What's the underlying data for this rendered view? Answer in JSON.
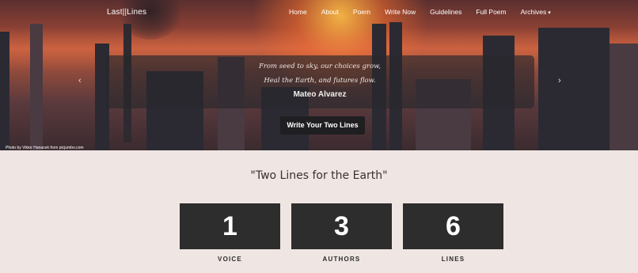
{
  "nav": {
    "brand": "Last||Lines",
    "links": [
      "Home",
      "About",
      "Poem",
      "Write Now",
      "Guidelines",
      "Full Poem",
      "Archives"
    ],
    "archives_caret": "▾"
  },
  "hero": {
    "poem_line_1": "From seed to sky, our choices grow,",
    "poem_line_2": "Heal the Earth, and futures flow.",
    "author": "Mateo Alvarez",
    "prev_icon": "chevron-left-icon",
    "next_icon": "chevron-right-icon",
    "prev_glyph": "‹",
    "next_glyph": "›",
    "cta_label": "Write Your Two Lines",
    "photo_credit": "Photo by Viktor Hanacek from picjumbo.com"
  },
  "main": {
    "title": "\"Two Lines for the Earth\"",
    "stats": [
      {
        "value": "1",
        "label": "VOICE"
      },
      {
        "value": "3",
        "label": "AUTHORS"
      },
      {
        "value": "6",
        "label": "LINES"
      }
    ]
  },
  "colors": {
    "page_bg": "#efe6e3",
    "stat_box": "#2d2d2d",
    "cta_bg": "#1f1f22"
  }
}
